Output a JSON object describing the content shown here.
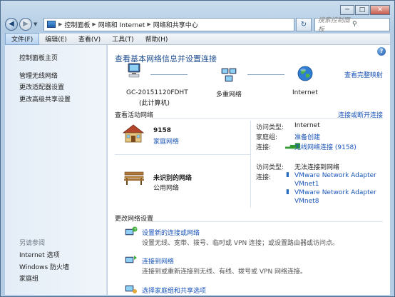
{
  "window": {
    "caption": {
      "minimize": "─",
      "maximize": "□",
      "close": "✕"
    }
  },
  "nav": {
    "back": "◀",
    "forward": "▶",
    "address": [
      "控制面板",
      "网络和 Internet",
      "网络和共享中心"
    ],
    "refresh": "↻",
    "search_placeholder": "搜索控制面板"
  },
  "menu": [
    "文件(F)",
    "编辑(E)",
    "查看(V)",
    "工具(T)",
    "帮助(H)"
  ],
  "sidebar": {
    "top_links": [
      "控制面板主页",
      "管理无线网络",
      "更改适配器设置",
      "更改高级共享设置"
    ],
    "see_also_label": "另请参阅",
    "see_also": [
      "Internet 选项",
      "Windows 防火墙",
      "家庭组"
    ]
  },
  "main": {
    "title": "查看基本网络信息并设置连接",
    "view_full_map": "查看完整映射",
    "map": {
      "computer_name": "GC-20151120FDHT",
      "computer_sub": "(此计算机)",
      "middle": "多重网络",
      "internet": "Internet"
    },
    "active_header": "查看活动网络",
    "connect_disconnect": "连接或断开连接",
    "net1": {
      "name": "9158",
      "type": "家庭网络",
      "access_label": "访问类型:",
      "access_value": "Internet",
      "homegroup_label": "家庭组:",
      "homegroup_value": "准备创建",
      "conn_label": "连接:",
      "conn_value": "无线网络连接 (9158)"
    },
    "net2": {
      "name": "未识别的网络",
      "type": "公用网络",
      "access_label": "访问类型:",
      "access_value": "无法连接到网络",
      "conn_label": "连接:",
      "conn_values": [
        "VMware Network Adapter",
        "VMnet1",
        "VMware Network Adapter",
        "VMnet8"
      ]
    },
    "change_header": "更改网络设置",
    "tasks": [
      {
        "title": "设置新的连接或网络",
        "desc": "设置无线、宽带、拨号、临时或 VPN 连接；或设置路由器或访问点。"
      },
      {
        "title": "连接到网络",
        "desc": "连接到或重新连接到无线、有线、拨号或 VPN 网络连接。"
      },
      {
        "title": "选择家庭组和共享选项",
        "desc": ""
      }
    ],
    "help": "?"
  }
}
